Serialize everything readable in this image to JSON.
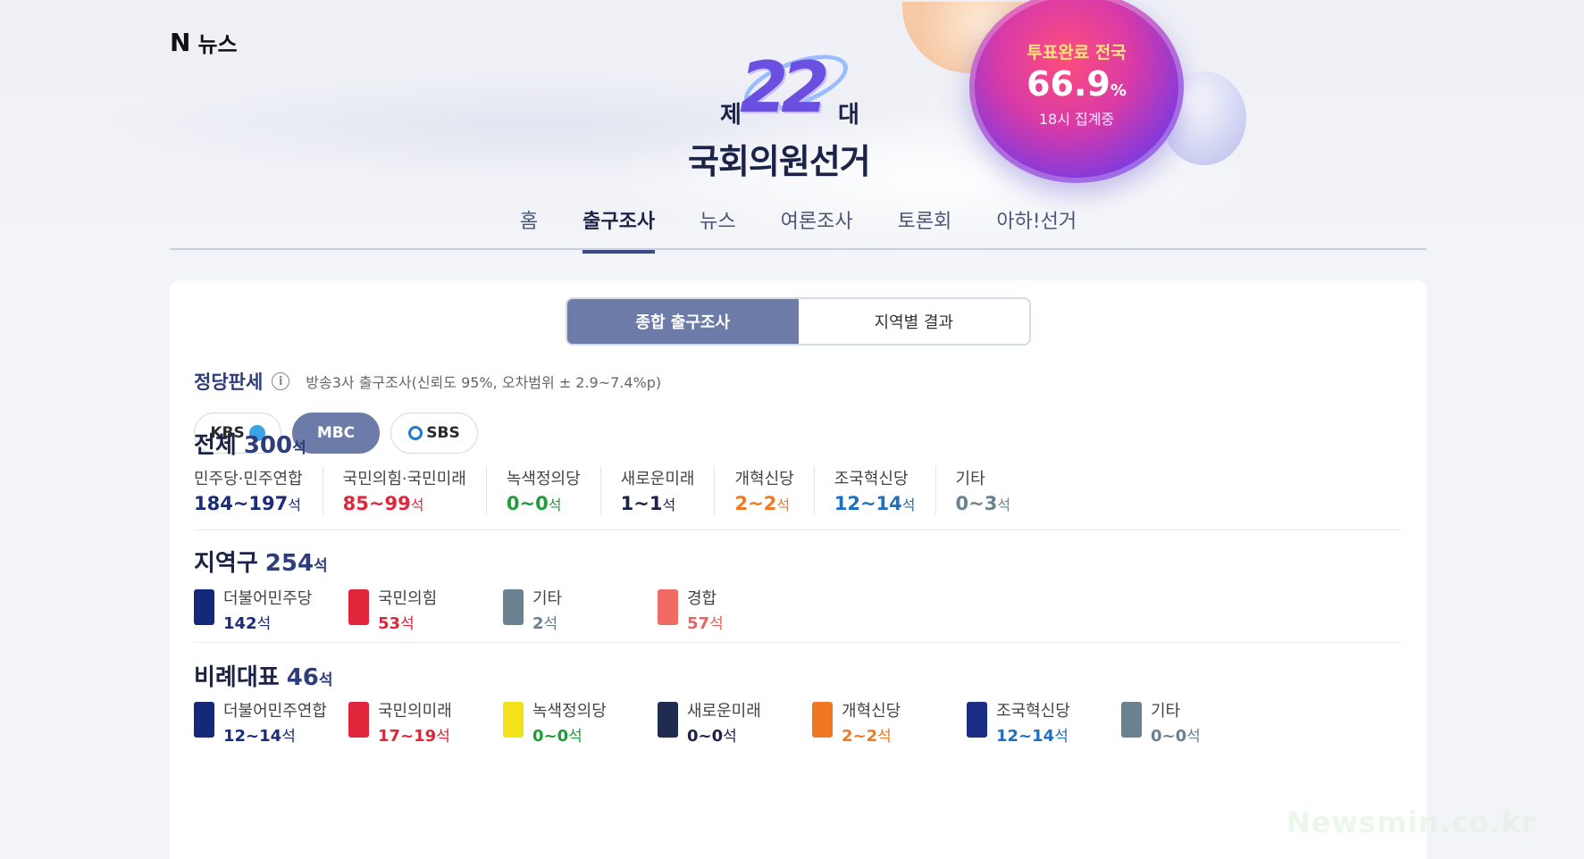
{
  "header": {
    "logo_mark": "N",
    "logo_text": "뉴스"
  },
  "hero": {
    "je": "제",
    "number": "22",
    "dae": "대",
    "title": "국회의원선거"
  },
  "turnout": {
    "label": "투표완료 전국",
    "value": "66.9",
    "unit": "%",
    "sub": "18시 집계중"
  },
  "nav": {
    "tabs": [
      "홈",
      "출구조사",
      "뉴스",
      "여론조사",
      "토론회",
      "아하!선거"
    ],
    "active_index": 1
  },
  "segment": {
    "items": [
      "종합 출구조사",
      "지역별 결과"
    ],
    "active_index": 0
  },
  "party_status": {
    "title": "정당판세",
    "info_icon": "i",
    "note": "방송3사 출구조사(신뢰도 95%, 오차범위 ± 2.9~7.4%p)"
  },
  "broadcasters": [
    {
      "label": "KBS",
      "active": false
    },
    {
      "label": "MBC",
      "active": true
    },
    {
      "label": "SBS",
      "active": false
    }
  ],
  "overall": {
    "title": "전체",
    "count": "300",
    "unit": "석",
    "items": [
      {
        "name": "민주당·민주연합",
        "range": "184~197",
        "unit": "석",
        "color": "#1a2c7a"
      },
      {
        "name": "국민의힘·국민미래",
        "range": "85~99",
        "unit": "석",
        "color": "#e0263a"
      },
      {
        "name": "녹색정의당",
        "range": "0~0",
        "unit": "석",
        "color": "#1f9a3c"
      },
      {
        "name": "새로운미래",
        "range": "1~1",
        "unit": "석",
        "color": "#1c2348"
      },
      {
        "name": "개혁신당",
        "range": "2~2",
        "unit": "석",
        "color": "#f07820"
      },
      {
        "name": "조국혁신당",
        "range": "12~14",
        "unit": "석",
        "color": "#1e6fc0"
      },
      {
        "name": "기타",
        "range": "0~3",
        "unit": "석",
        "color": "#6a8190"
      }
    ]
  },
  "district": {
    "title": "지역구",
    "count": "254",
    "unit": "석",
    "items": [
      {
        "name": "더불어민주당",
        "value": "142",
        "unit": "석",
        "color": "#1a2c7a",
        "badge": "#15287a"
      },
      {
        "name": "국민의힘",
        "value": "53",
        "unit": "석",
        "color": "#e0263a",
        "badge": "#e0263a"
      },
      {
        "name": "기타",
        "value": "2",
        "unit": "석",
        "color": "#6a8190",
        "badge": "#6a8190"
      },
      {
        "name": "경합",
        "value": "57",
        "unit": "석",
        "color": "#f06060",
        "badge": "#f26a64"
      }
    ]
  },
  "proportional": {
    "title": "비례대표",
    "count": "46",
    "unit": "석",
    "items": [
      {
        "name": "더불어민주연합",
        "value": "12~14",
        "unit": "석",
        "color": "#1a2c7a",
        "badge": "#15287a"
      },
      {
        "name": "국민의미래",
        "value": "17~19",
        "unit": "석",
        "color": "#e0263a",
        "badge": "#e0263a"
      },
      {
        "name": "녹색정의당",
        "value": "0~0",
        "unit": "석",
        "color": "#1f9a3c",
        "badge": "#f2e21a"
      },
      {
        "name": "새로운미래",
        "value": "0~0",
        "unit": "석",
        "color": "#1c2348",
        "badge": "#1f2b4f"
      },
      {
        "name": "개혁신당",
        "value": "2~2",
        "unit": "석",
        "color": "#f07820",
        "badge": "#f07820"
      },
      {
        "name": "조국혁신당",
        "value": "12~14",
        "unit": "석",
        "color": "#1e6fc0",
        "badge": "#1a2e86"
      },
      {
        "name": "기타",
        "value": "0~0",
        "unit": "석",
        "color": "#6a8190",
        "badge": "#6a8190"
      }
    ]
  },
  "watermark": "Newsmin.co.kr"
}
